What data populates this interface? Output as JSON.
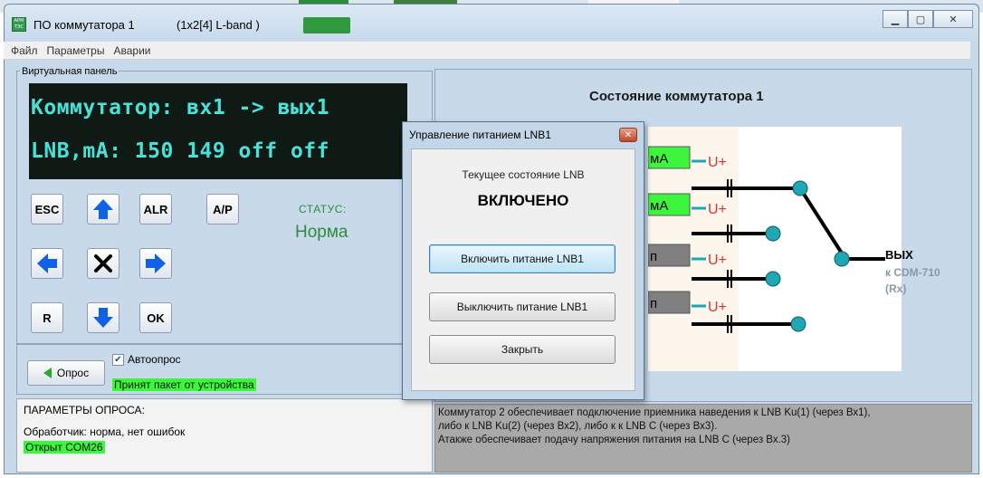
{
  "window": {
    "title": "ПО коммутатора 1",
    "subtitle": "(1x2[4] L-band )",
    "icon_text": "АРМ ТЭС"
  },
  "menu": [
    "Файл",
    "Параметры",
    "Аварии"
  ],
  "virtual_panel": {
    "label": "Виртуальная панель",
    "lcd_line1": "Коммутатор: вх1 -> вых1",
    "lcd_line2": "LNB,mA: 150 149 off off",
    "buttons": {
      "esc": "ESC",
      "alr": "ALR",
      "ap": "A/P",
      "r": "R",
      "ok": "OK"
    },
    "status_label": "СТАТУС:",
    "status_value": "Норма"
  },
  "poll": {
    "button_label": "Опрос",
    "autopoll_label": "Автоопрос",
    "autopoll_checked": true,
    "packet_text": "Принят пакет от устройства"
  },
  "params": {
    "title": "ПАРАМЕТРЫ ОПРОСА:",
    "handler": "Обработчик: норма, нет ошибок",
    "port": "Открыт COM26"
  },
  "switch_state": {
    "title": "Состояние коммутатора 1",
    "inputs": [
      {
        "label": "мА",
        "color": "#3cf53c"
      },
      {
        "label": "мА",
        "color": "#3cf53c"
      },
      {
        "label": "п",
        "color": "#808080"
      },
      {
        "label": "п",
        "color": "#808080"
      }
    ],
    "voltage_label": "U+",
    "output_label": "ВЫХ",
    "output_dest1": "к CDM-710",
    "output_dest2": "(Rx)"
  },
  "description": [
    "Коммутатор 2 обеспечивает подключение приемника наведения к LNB Ku(1) (через Вх1),",
    "либо к LNB Ku(2) (через Вх2),  либо к к LNB C (через Вх3).",
    "Атакже обеспечивает подачу напряжения питания на LNB C (через Вх.3)"
  ],
  "dialog": {
    "title": "Управление питанием LNB1",
    "caption": "Текущее состояние LNB",
    "state": "ВКЛЮЧЕНО",
    "btn_on": "Включить питание LNB1",
    "btn_off": "Выключить питание LNB1",
    "btn_close": "Закрыть"
  },
  "colors": {
    "lcd_text": "#49e0d8",
    "status": "#2e8b3c",
    "highlight": "#3cf53c",
    "node": "#1fa7b5"
  }
}
